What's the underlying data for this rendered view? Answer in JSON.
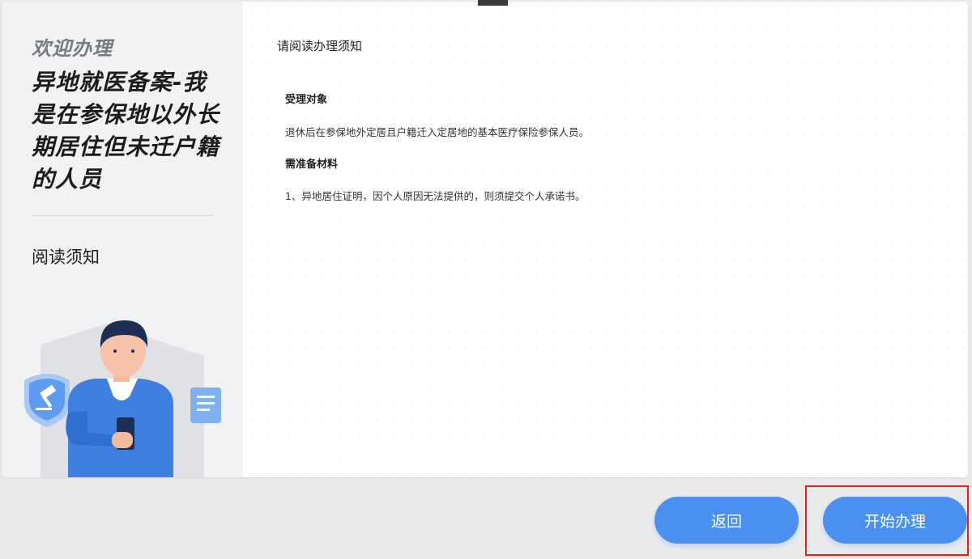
{
  "sidebar": {
    "welcome": "欢迎办理",
    "service_title": "异地就医备案-我是在参保地以外长期居住但未迁户籍的人员",
    "step_label": "阅读须知"
  },
  "main": {
    "notice_title": "请阅读办理须知",
    "sections": [
      {
        "heading": "受理对象",
        "text": "退休后在参保地外定居且户籍迁入定居地的基本医疗保险参保人员。"
      },
      {
        "heading": "需准备材料",
        "text": "1、异地居住证明，因个人原因无法提供的，则须提交个人承诺书。"
      }
    ]
  },
  "buttons": {
    "back": "返回",
    "start": "开始办理"
  },
  "colors": {
    "primary": "#4a90f0",
    "highlight": "#e8201a",
    "sidebar_bg": "#f1f2f4"
  },
  "icons": {
    "shield": "gavel-shield-icon",
    "document": "document-icon",
    "person": "person-illustration"
  }
}
